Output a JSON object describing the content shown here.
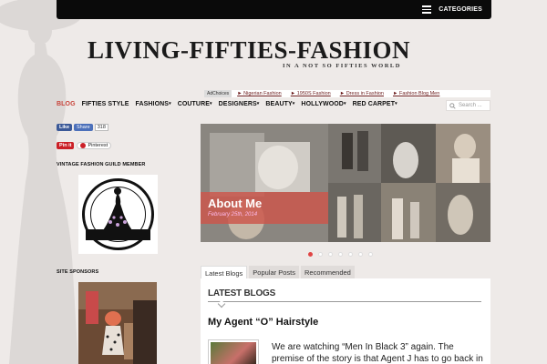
{
  "topbar": {
    "categories_label": "CATEGORIES"
  },
  "site": {
    "logo": "Living-Fifties-Fashion",
    "tagline": "IN A NOT SO FIFTIES WORLD"
  },
  "ads": {
    "adchoices": "AdChoices",
    "links": [
      "► Nigerian Fashion",
      "► 1950S Fashion",
      "► Dress in Fashion",
      "► Fashion Blog Men"
    ]
  },
  "nav": {
    "items": [
      {
        "label": "BLOG",
        "caret": ""
      },
      {
        "label": "FIFTIES STYLE",
        "caret": ""
      },
      {
        "label": "FASHIONS",
        "caret": "▾"
      },
      {
        "label": "COUTURE",
        "caret": "▾"
      },
      {
        "label": "DESIGNERS",
        "caret": "▾"
      },
      {
        "label": "BEAUTY",
        "caret": "▾"
      },
      {
        "label": "HOLLYWOOD",
        "caret": "▾"
      },
      {
        "label": "RED CARPET",
        "caret": "▾"
      }
    ]
  },
  "search": {
    "placeholder": "Search ..."
  },
  "sidebar": {
    "fb_like": "Like",
    "fb_share": "Share",
    "fb_count": "318",
    "pin_it": "Pin it",
    "pinterest": "Pinterest",
    "guild_heading": "VINTAGE FASHION GUILD MEMBER",
    "sponsors_heading": "SITE SPONSORS"
  },
  "slider": {
    "title": "About Me",
    "date": "February 25th, 2014",
    "slide_count": 7,
    "active_index": 0
  },
  "tabs": [
    "Latest Blogs",
    "Popular Posts",
    "Recommended"
  ],
  "content": {
    "heading": "LATEST BLOGS",
    "post_title": "My Agent “O” Hairstyle",
    "excerpt": "We are watching “Men In Black 3” again. The premise of the story is that Agent J has to go back in"
  },
  "colors": {
    "accent": "#c8443a",
    "caption": "#cd554b",
    "topbar": "#0a0a0a",
    "background": "#eeeae8"
  }
}
